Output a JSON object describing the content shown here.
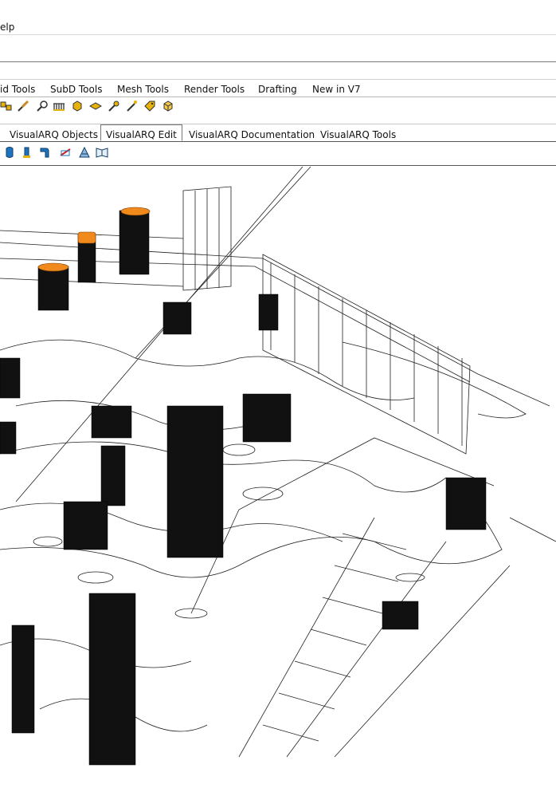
{
  "menubar": {
    "help_label": "elp"
  },
  "ribbon_tabs": [
    "id Tools",
    "SubD Tools",
    "Mesh Tools",
    "Render Tools",
    "Drafting",
    "New in V7"
  ],
  "visualarq_tabs": [
    "VisualARQ Objects",
    "VisualARQ Edit",
    "VisualARQ Documentation",
    "VisualARQ Tools"
  ],
  "active_tab": "VisualARQ Edit",
  "toolbar1_icons": [
    "block-icon",
    "brush-icon",
    "magnifier-icon",
    "railing-icon",
    "box-icon",
    "slab-icon",
    "key-icon",
    "wand-icon",
    "tag-icon",
    "cube-icon"
  ],
  "toolbar2_icons": [
    "column-icon",
    "beam-icon",
    "pipe-icon",
    "section-icon",
    "level-icon",
    "book-icon"
  ],
  "colors": {
    "accent_orange": "#f08a1c",
    "icon_blue": "#1e73be",
    "icon_yellow": "#e8b20d"
  }
}
